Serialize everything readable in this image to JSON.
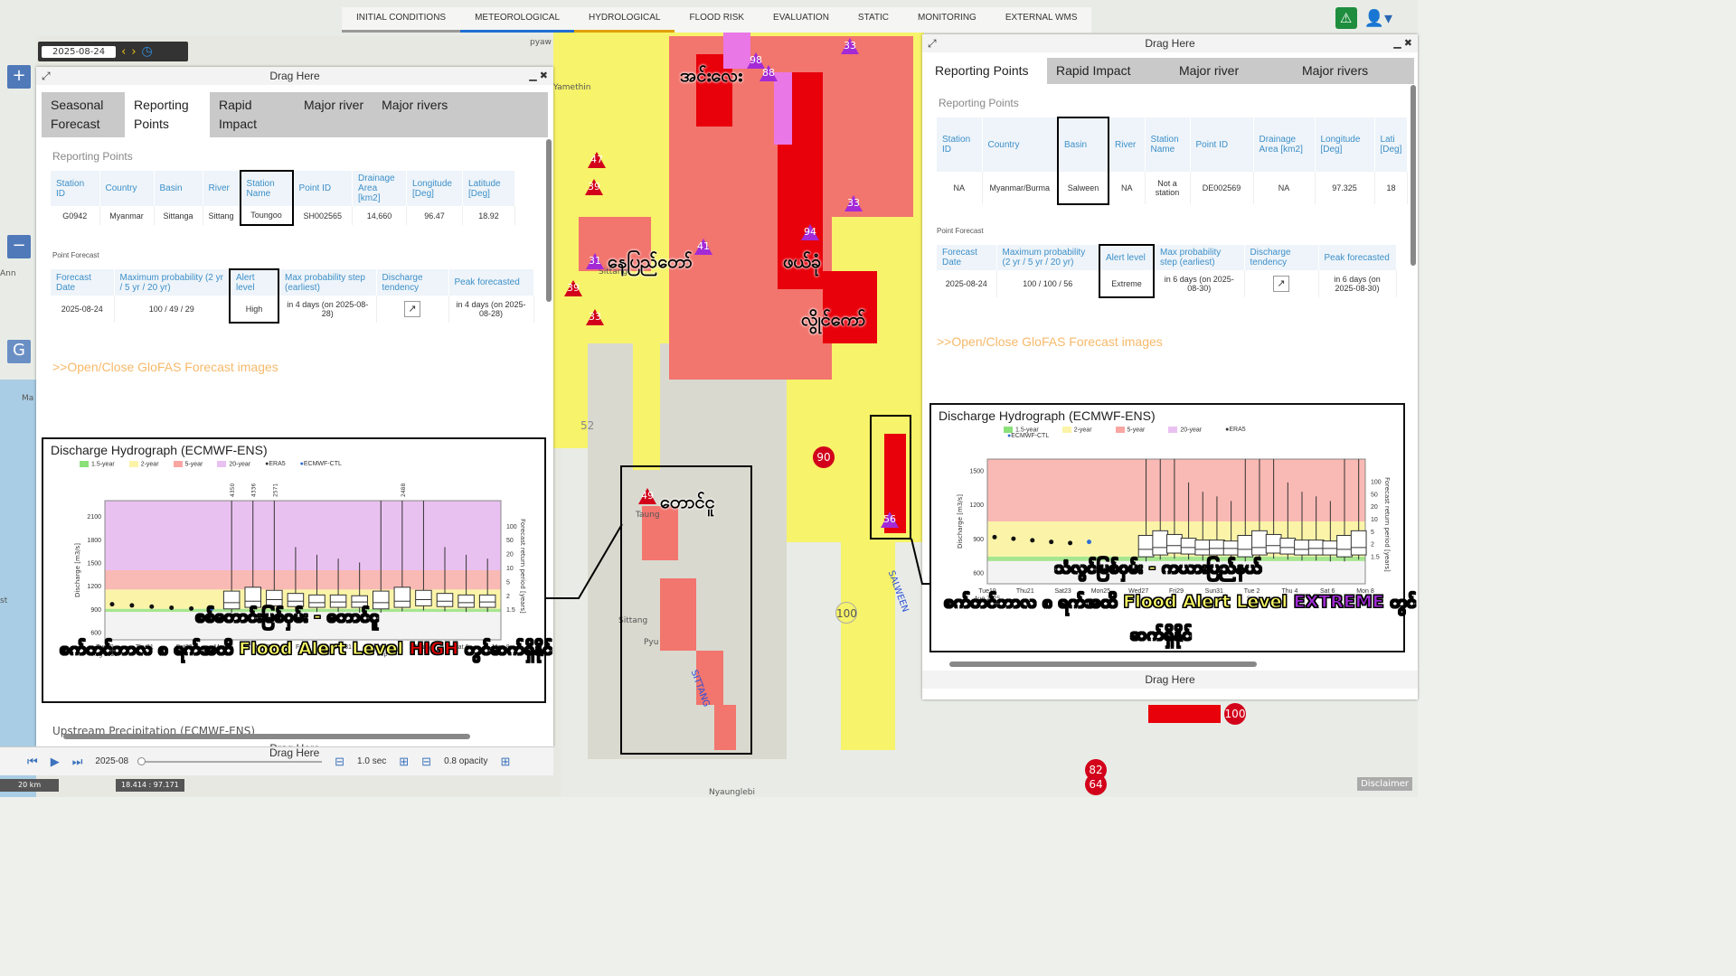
{
  "topnav": {
    "tabs": [
      "INITIAL CONDITIONS",
      "METEOROLOGICAL",
      "HYDROLOGICAL",
      "FLOOD RISK",
      "EVALUATION",
      "STATIC",
      "MONITORING",
      "EXTERNAL WMS"
    ]
  },
  "date_control": {
    "date": "2025-08-24"
  },
  "map_labels": {
    "city1": "အင်းလေး",
    "city2": "နေပြည်တော်",
    "city3": "ဖယ်ခုံ",
    "city4": "လွိုင်ကော်",
    "city5": "တောင်ငူ",
    "sittang_small": "Sittang",
    "pyu": "Pyu",
    "sittang_river": "SITTANG",
    "salween_river": "SALWEEN",
    "sittang_town": "Sittang",
    "taungoo_small": "Taung",
    "nyaunglebi": "Nyaunglebi",
    "yamethin": "Yamethin",
    "pyaw": "pyaw"
  },
  "markers": {
    "m98": "98",
    "m88": "88",
    "m33a": "33",
    "m47": "47",
    "m39a": "39",
    "m31": "31",
    "m41": "41",
    "m39b": "39",
    "m33b": "33",
    "m94": "94",
    "m33c": "33",
    "m90": "90",
    "m56": "56",
    "m49": "49",
    "m100a": "100",
    "m100b": "100",
    "m82": "82",
    "m64": "64",
    "m52": "52"
  },
  "caption_left": {
    "line1": "စစ်တောင်းမြစ်ဝှမ်း - တောင်ငူ",
    "line2_pre": "စက်တင်ဘာလ ၈ ရက်အထိ Flood Alert Level ",
    "line2_level": "HIGH",
    "line2_post": " တွင်ဆက်ရှိနိုင်"
  },
  "caption_right": {
    "line1": "သံလွင်မြစ်ဝှမ်း - ကယားပြည်နယ်",
    "line2_pre": "စက်တင်ဘာလ ၈ ရက်အထိ Flood Alert Level ",
    "line2_level": "EXTREME",
    "line2_post": " တွင်",
    "line3": "ဆက်ရှိနိုင်"
  },
  "left_panel": {
    "drag": "Drag Here",
    "drag_bottom": "Drag Here",
    "tabs": [
      "Seasonal Forecast",
      "Reporting Points",
      "Rapid Impact",
      "Major river",
      "Major rivers"
    ],
    "section": "Reporting Points",
    "headers": [
      "Station ID",
      "Country",
      "Basin",
      "River",
      "Station Name",
      "Point ID",
      "Drainage Area [km2]",
      "Longitude [Deg]",
      "Latitude [Deg]"
    ],
    "row": [
      "G0942",
      "Myanmar",
      "Sittanga",
      "Sittang",
      "Toungoo",
      "SH002565",
      "14,660",
      "96.47",
      "18.92"
    ],
    "forecast_title": "Point Forecast",
    "fheaders": [
      "Forecast Date",
      "Maximum probability (2 yr / 5 yr / 20 yr)",
      "Alert level",
      "Max probability step (earliest)",
      "Discharge tendency",
      "Peak forecasted"
    ],
    "frow": [
      "2025-08-24",
      "100 / 49 / 29",
      "High",
      "in 4 days (on 2025-08-28)",
      "",
      "in 4 days (on 2025-08-28)"
    ],
    "link": ">>Open/Close GloFAS Forecast images",
    "hydro_title": "Discharge Hydrograph (ECMWF-ENS)",
    "legend": [
      "1.5-year",
      "2-year",
      "5-year",
      "20-year",
      "ERA5",
      "ECMWF-CTL"
    ],
    "ylabel": "Discharge [m3/s]",
    "y2label": "Forecast return period [years]",
    "yticks": [
      "2100",
      "1800",
      "1500",
      "1200",
      "900",
      "600"
    ],
    "rticks": [
      "100",
      "50",
      "20",
      "10",
      "5",
      "2",
      "1.5"
    ],
    "xticks": [
      "Tue19 Aug 2025",
      "Thu21",
      "Sat23",
      "Mon25",
      "Wed27",
      "Fri29",
      "Sun31",
      "Tue 2 Sep",
      "Thu 4",
      "Sat 6",
      "Mon 8"
    ],
    "top_values": [
      "4350",
      "4336",
      "2571",
      "2488"
    ],
    "more": "Upstream Precipitation (ECMWF-ENS)"
  },
  "right_panel": {
    "drag": "Drag Here",
    "drag_bottom": "Drag Here",
    "tabs": [
      "Reporting Points",
      "Rapid Impact",
      "Major river",
      "Major rivers"
    ],
    "section": "Reporting Points",
    "headers": [
      "Station ID",
      "Country",
      "Basin",
      "River",
      "Station Name",
      "Point ID",
      "Drainage Area [km2]",
      "Longitude [Deg]",
      "Lati [Deg]"
    ],
    "row": [
      "NA",
      "Myanmar/Burma",
      "Salween",
      "NA",
      "Not a station",
      "DE002569",
      "NA",
      "97.325",
      "18"
    ],
    "forecast_title": "Point Forecast",
    "fheaders": [
      "Forecast Date",
      "Maximum probability (2 yr / 5 yr / 20 yr)",
      "Alert level",
      "Max probability step (earliest)",
      "Discharge tendency",
      "Peak forecasted"
    ],
    "frow": [
      "2025-08-24",
      "100 / 100 / 56",
      "Extreme",
      "in 6 days (on 2025-08-30)",
      "",
      "in 6 days (on 2025-08-30)"
    ],
    "link": ">>Open/Close GloFAS Forecast images",
    "hydro_title": "Discharge Hydrograph (ECMWF-ENS)",
    "legend": [
      "1.5-year",
      "2-year",
      "5-year",
      "20-year",
      "ERA5",
      "ECMWF-CTL"
    ],
    "ylabel": "Discharge [m3/s]",
    "y2label": "Forecast return period [years]",
    "yticks": [
      "1500",
      "1200",
      "900",
      "600"
    ],
    "rticks": [
      "100",
      "50",
      "20",
      "10",
      "5",
      "2",
      "1.5"
    ],
    "xticks": [
      "Tue19 Aug 2025",
      "Thu21",
      "Sat23",
      "Mon25",
      "Wed27",
      "Fri29",
      "Sun31",
      "Tue 2 Sep",
      "Thu 4",
      "Sat 6",
      "Mon 8"
    ]
  },
  "bottombar": {
    "month": "2025-08",
    "speed": "1.0 sec",
    "opacity": "0.8 opacity"
  },
  "scale": "20 km",
  "coords": "18.414 : 97.171",
  "disclaimer": "Disclaimer",
  "map_side": {
    "ann": "Ann",
    "ma": "Ma",
    "st": "st",
    "g": "G"
  },
  "chart_data": [
    {
      "type": "box",
      "title": "Discharge Hydrograph (ECMWF-ENS)",
      "ylabel": "Discharge [m3/s]",
      "ylim": [
        500,
        2300
      ],
      "thresholds": {
        "1.5-year": 860,
        "2-year": 900,
        "5-year": 1150,
        "20-year": 1400
      },
      "era5": [
        {
          "x": "Aug19",
          "y": 960
        },
        {
          "x": "Aug20",
          "y": 945
        },
        {
          "x": "Aug21",
          "y": 930
        },
        {
          "x": "Aug22",
          "y": 915
        },
        {
          "x": "Aug23",
          "y": 905
        }
      ],
      "boxes": [
        {
          "low": 850,
          "q1": 900,
          "median": 980,
          "q3": 1130,
          "high": 2300
        },
        {
          "low": 870,
          "q1": 920,
          "median": 1000,
          "q3": 1180,
          "high": 2300
        },
        {
          "low": 880,
          "q1": 940,
          "median": 1020,
          "q3": 1140,
          "high": 2300
        },
        {
          "low": 870,
          "q1": 930,
          "median": 1000,
          "q3": 1100,
          "high": 1700
        },
        {
          "low": 860,
          "q1": 920,
          "median": 980,
          "q3": 1080,
          "high": 1600
        },
        {
          "low": 860,
          "q1": 920,
          "median": 990,
          "q3": 1080,
          "high": 1550
        },
        {
          "low": 850,
          "q1": 920,
          "median": 990,
          "q3": 1070,
          "high": 1500
        }
      ]
    }
  ]
}
